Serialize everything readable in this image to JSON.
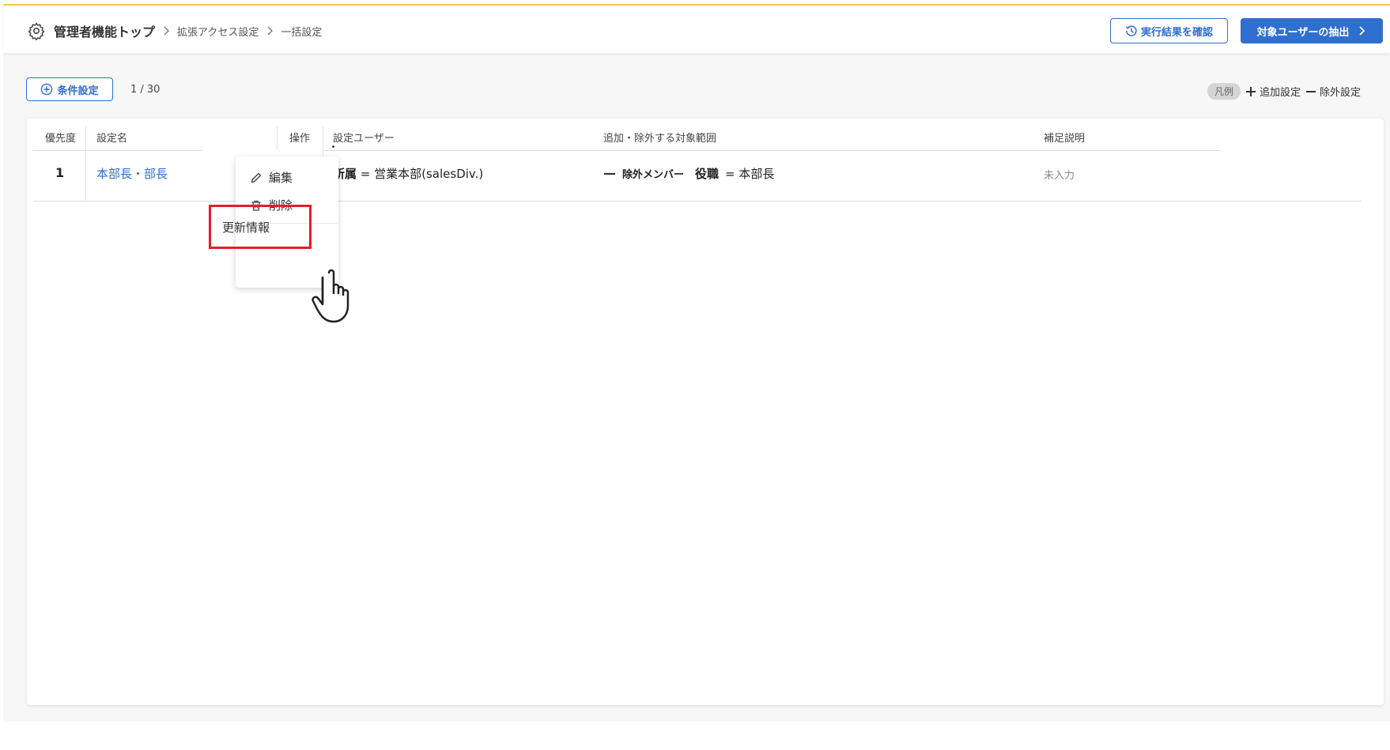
{
  "header": {
    "breadcrumb": {
      "root": "管理者機能トップ",
      "level2": "拡張アクセス設定",
      "level3": "一括設定"
    },
    "result_button": "実行結果を確認",
    "extract_button": "対象ユーザーの抽出"
  },
  "toolbar": {
    "condition_button": "条件設定",
    "count": "1 / 30"
  },
  "legend": {
    "badge": "凡例",
    "add": "追加設定",
    "exclude": "除外設定"
  },
  "table": {
    "headers": {
      "priority": "優先度",
      "name": "設定名",
      "operation": "操作",
      "users": "設定ユーザー",
      "scope": "追加・除外する対象範囲",
      "note": "補足説明"
    },
    "rows": [
      {
        "priority": "1",
        "name": "本部長・部長",
        "users_key": "所属",
        "users_value": "= 営業本部(salesDiv.)",
        "scope_type": "除外メンバー",
        "scope_key": "役職",
        "scope_value": "= 本部長",
        "note": "未入力"
      }
    ]
  },
  "menu": {
    "edit": "編集",
    "delete": "削除",
    "update_info": "更新情報"
  },
  "colors": {
    "accent": "#2f6fcf",
    "highlight": "#e0202a",
    "top_border": "#f5c84a"
  }
}
